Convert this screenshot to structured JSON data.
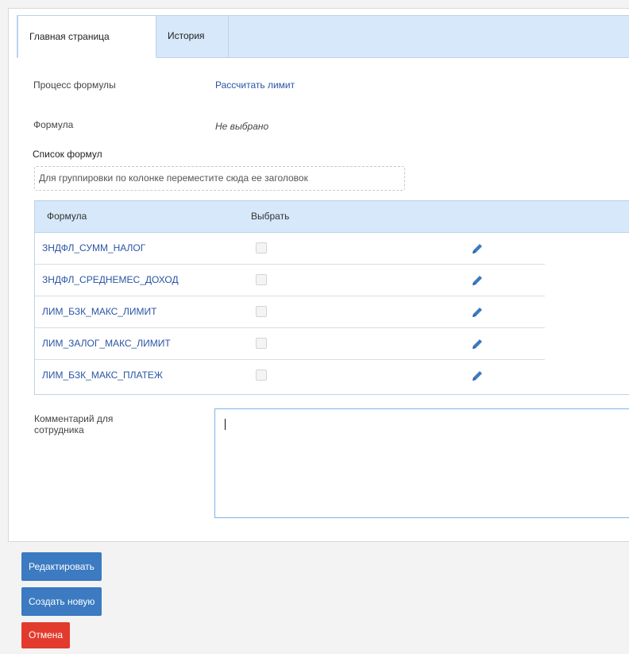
{
  "tabs": {
    "main": "Главная страница",
    "history": "История"
  },
  "fields": {
    "process_label": "Процесс формулы",
    "process_value": "Рассчитать лимит",
    "formula_label": "Формула",
    "formula_value": "Не выбрано"
  },
  "formula_list": {
    "title": "Список формул",
    "group_hint": "Для группировки по колонке переместите сюда ее заголовок",
    "columns": [
      "Формула",
      "Выбрать"
    ],
    "rows": [
      {
        "name": "ЗНДФЛ_СУММ_НАЛОГ",
        "selected": false
      },
      {
        "name": "ЗНДФЛ_СРЕДНЕМЕС_ДОХОД",
        "selected": false
      },
      {
        "name": "ЛИМ_БЗК_МАКС_ЛИМИТ",
        "selected": false
      },
      {
        "name": "ЛИМ_ЗАЛОГ_МАКС_ЛИМИТ",
        "selected": false
      },
      {
        "name": "ЛИМ_БЗК_МАКС_ПЛАТЕЖ",
        "selected": false
      }
    ],
    "edit_icon": "pencil-icon"
  },
  "comment": {
    "label": "Комментарий для сотрудника",
    "value": ""
  },
  "buttons": {
    "edit": "Редактировать",
    "create": "Создать новую",
    "cancel": "Отмена"
  },
  "colors": {
    "accent_blue": "#3c7ac1",
    "cancel_red": "#e33a2e",
    "link": "#2a55a4",
    "header_bg": "#d6e8f9"
  }
}
